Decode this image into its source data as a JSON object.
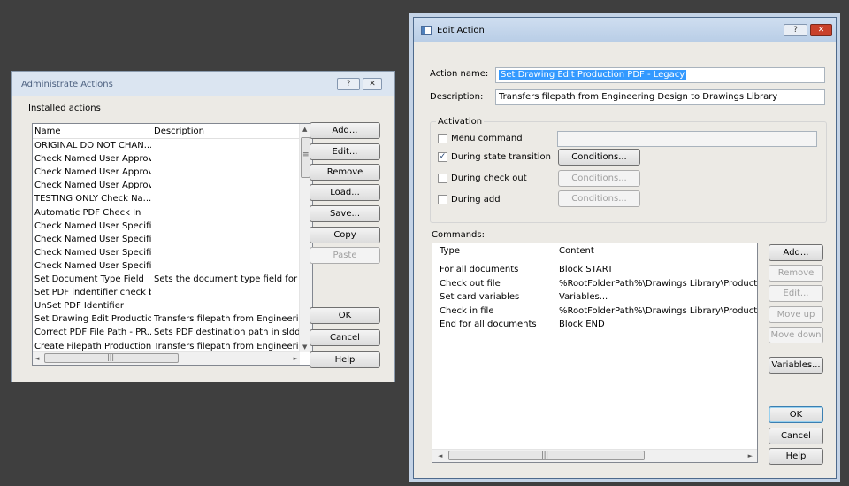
{
  "admin": {
    "title": "Administrate Actions",
    "help_glyph": "?",
    "close_glyph": "✕",
    "section_label": "Installed actions",
    "columns": [
      "Name",
      "Description"
    ],
    "rows": [
      {
        "name": "ORIGINAL DO NOT CHAN...",
        "desc": ""
      },
      {
        "name": "Check Named User Approv...",
        "desc": ""
      },
      {
        "name": "Check Named User Approv...",
        "desc": ""
      },
      {
        "name": "Check Named User Approv...",
        "desc": ""
      },
      {
        "name": "TESTING ONLY Check Na...",
        "desc": ""
      },
      {
        "name": "Automatic PDF Check In",
        "desc": ""
      },
      {
        "name": "Check Named User Specifi...",
        "desc": ""
      },
      {
        "name": "Check Named User Specifi...",
        "desc": ""
      },
      {
        "name": "Check Named User Specifi...",
        "desc": ""
      },
      {
        "name": "Check Named User Specifi...",
        "desc": ""
      },
      {
        "name": "Set Document Type Field",
        "desc": "Sets the document type field for PD"
      },
      {
        "name": "Set PDF indentifier check box",
        "desc": ""
      },
      {
        "name": "UnSet PDF Identifier",
        "desc": ""
      },
      {
        "name": "Set Drawing Edit Production...",
        "desc": "Transfers filepath from Engineering"
      },
      {
        "name": "Correct PDF File Path - PR...",
        "desc": "Sets PDF destination path in slddrw"
      },
      {
        "name": "Create Filepath Production...",
        "desc": "Transfers filepath from Engineering"
      }
    ],
    "buttons": {
      "add": "Add...",
      "edit": "Edit...",
      "remove": "Remove",
      "load": "Load...",
      "save": "Save...",
      "copy": "Copy",
      "paste": "Paste",
      "ok": "OK",
      "cancel": "Cancel",
      "help": "Help"
    },
    "scroll": {
      "up": "▲",
      "down": "▼",
      "left": "◄",
      "right": "►",
      "grip_v": "≡",
      "grip_h": "|||"
    }
  },
  "edit": {
    "title": "Edit Action",
    "help_glyph": "?",
    "close_glyph": "✕",
    "action_name_label": "Action name:",
    "action_name_value": "Set Drawing Edit Production PDF - Legacy",
    "description_label": "Description:",
    "description_value": "Transfers filepath from Engineering Design to Drawings Library",
    "activation_label": "Activation",
    "menu_command_label": "Menu command",
    "menu_command_checked": false,
    "menu_command_value": "",
    "state_transition_label": "During state transition",
    "state_transition_checked": true,
    "check_out_label": "During check out",
    "check_out_checked": false,
    "add_label": "During add",
    "add_checked": false,
    "conditions_label": "Conditions...",
    "check_mark": "✓",
    "commands_label": "Commands:",
    "columns": [
      "Type",
      "Content"
    ],
    "commands": [
      {
        "type": "For all documents",
        "content": "Block START"
      },
      {
        "type": "Check out file",
        "content": "%RootFolderPath%\\Drawings Library\\Product\\%t-rar"
      },
      {
        "type": "Set card variables",
        "content": "Variables..."
      },
      {
        "type": "Check in file",
        "content": "%RootFolderPath%\\Drawings Library\\Product\\%t-rar"
      },
      {
        "type": "End for all documents",
        "content": "Block END"
      }
    ],
    "buttons": {
      "add": "Add...",
      "remove": "Remove",
      "edit": "Edit...",
      "move_up": "Move up",
      "move_down": "Move down",
      "variables": "Variables...",
      "ok": "OK",
      "cancel": "Cancel",
      "help": "Help"
    },
    "scroll": {
      "left": "◄",
      "right": "►",
      "grip_h": "|||"
    }
  }
}
